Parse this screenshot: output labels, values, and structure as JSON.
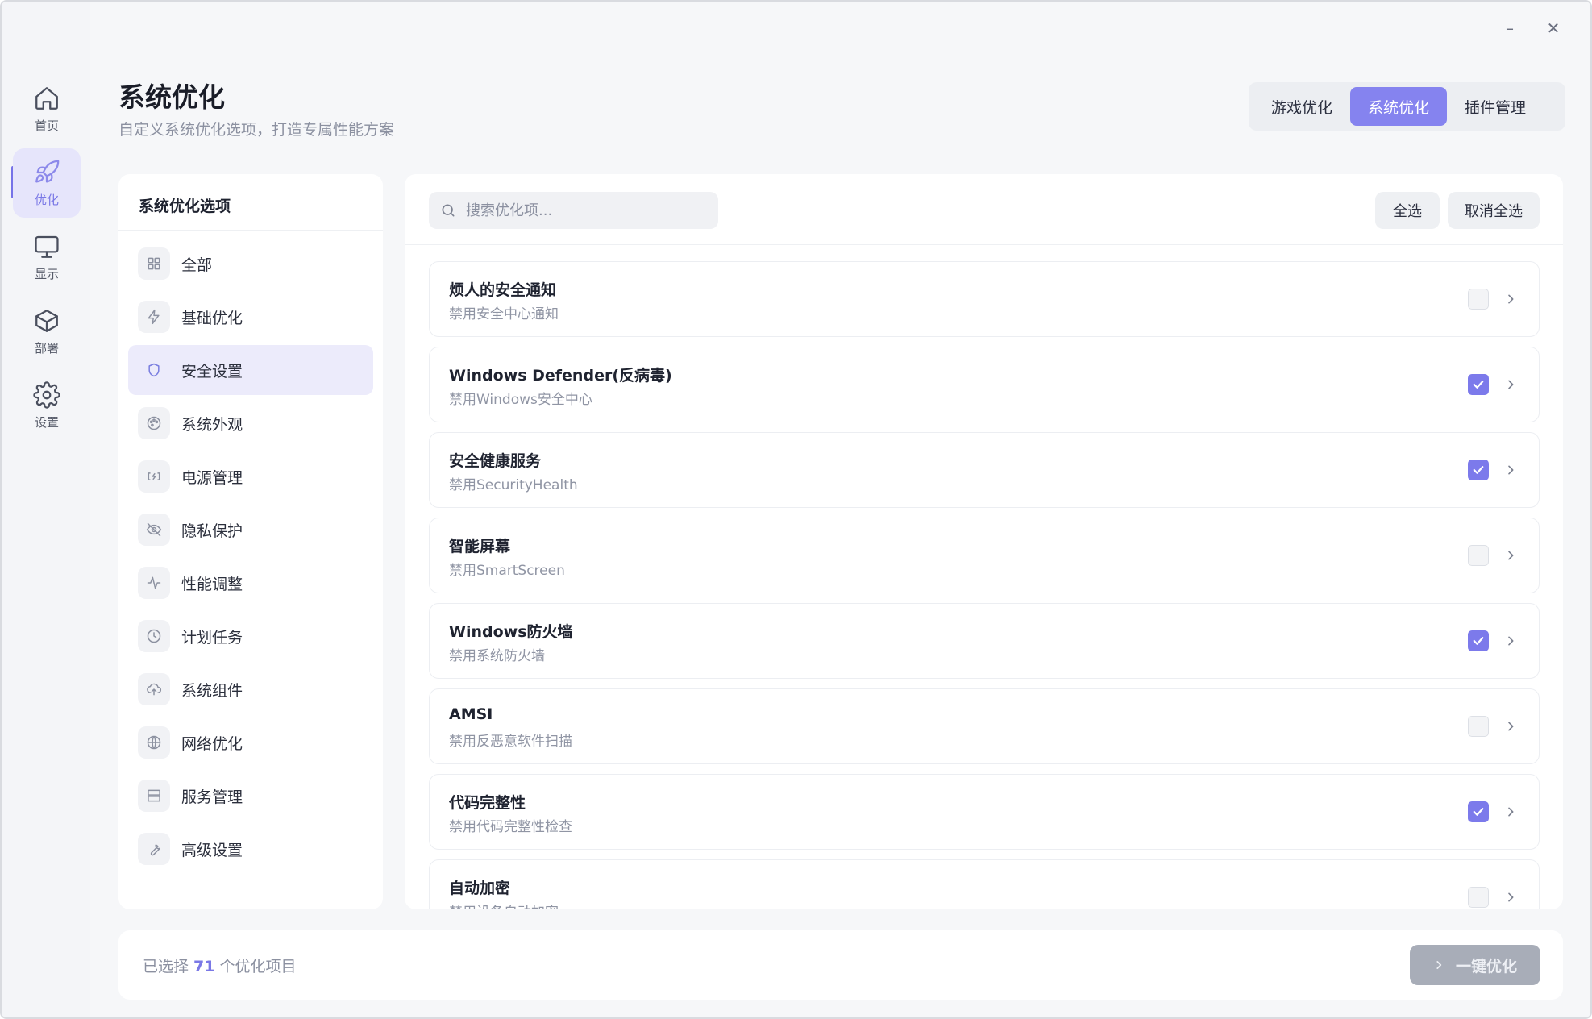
{
  "window": {
    "minimize_glyph": "–",
    "close_glyph": "✕"
  },
  "rail": [
    {
      "label": "首页",
      "icon": "home-icon"
    },
    {
      "label": "优化",
      "icon": "rocket-icon",
      "active": true
    },
    {
      "label": "显示",
      "icon": "monitor-icon"
    },
    {
      "label": "部署",
      "icon": "package-icon"
    },
    {
      "label": "设置",
      "icon": "gear-icon"
    }
  ],
  "header": {
    "title": "系统优化",
    "subtitle": "自定义系统优化选项，打造专属性能方案"
  },
  "tabs": [
    {
      "label": "游戏优化"
    },
    {
      "label": "系统优化",
      "active": true
    },
    {
      "label": "插件管理"
    }
  ],
  "options_panel": {
    "title": "系统优化选项",
    "items": [
      {
        "label": "全部",
        "icon": "grid-icon"
      },
      {
        "label": "基础优化",
        "icon": "lightning-icon"
      },
      {
        "label": "安全设置",
        "icon": "shield-icon",
        "active": true
      },
      {
        "label": "系统外观",
        "icon": "palette-icon"
      },
      {
        "label": "电源管理",
        "icon": "battery-icon"
      },
      {
        "label": "隐私保护",
        "icon": "eye-off-icon"
      },
      {
        "label": "性能调整",
        "icon": "activity-icon"
      },
      {
        "label": "计划任务",
        "icon": "clock-icon"
      },
      {
        "label": "系统组件",
        "icon": "cloud-upload-icon"
      },
      {
        "label": "网络优化",
        "icon": "globe-icon"
      },
      {
        "label": "服务管理",
        "icon": "server-icon"
      },
      {
        "label": "高级设置",
        "icon": "wrench-icon"
      }
    ]
  },
  "main": {
    "search": {
      "placeholder": "搜索优化项...",
      "value": ""
    },
    "select_all_label": "全选",
    "deselect_all_label": "取消全选",
    "items": [
      {
        "title": "烦人的安全通知",
        "desc": "禁用安全中心通知",
        "checked": false
      },
      {
        "title": "Windows Defender(反病毒)",
        "desc": "禁用Windows安全中心",
        "checked": true
      },
      {
        "title": "安全健康服务",
        "desc": "禁用SecurityHealth",
        "checked": true
      },
      {
        "title": "智能屏幕",
        "desc": "禁用SmartScreen",
        "checked": false
      },
      {
        "title": "Windows防火墙",
        "desc": "禁用系统防火墙",
        "checked": true
      },
      {
        "title": "AMSI",
        "desc": "禁用反恶意软件扫描",
        "checked": false
      },
      {
        "title": "代码完整性",
        "desc": "禁用代码完整性检查",
        "checked": true
      },
      {
        "title": "自动加密",
        "desc": "禁用设备自动加密",
        "checked": false
      }
    ]
  },
  "footer": {
    "prefix": "已选择",
    "count": "71",
    "suffix": "个优化项目",
    "action_label": "一键优化"
  },
  "colors": {
    "accent": "#8583ef",
    "checkbox_on": "#7c7aeb",
    "disabled_button": "#a8adb8"
  }
}
